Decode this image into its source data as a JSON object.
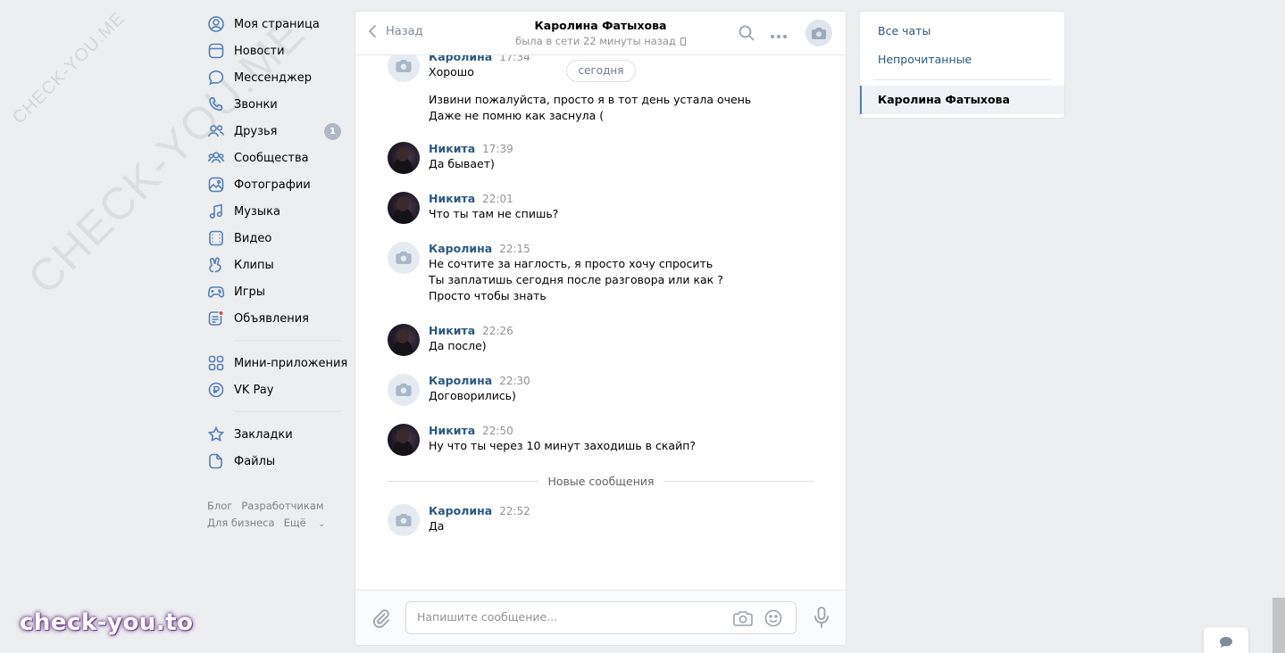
{
  "watermark": {
    "small": "CHECK-YOU.ME",
    "large": "CHECK-YOU.ME",
    "brand": "check-you.to"
  },
  "nav": {
    "items": [
      {
        "label": "Моя страница",
        "icon": "user-circle-icon"
      },
      {
        "label": "Новости",
        "icon": "news-icon"
      },
      {
        "label": "Мессенджер",
        "icon": "message-icon"
      },
      {
        "label": "Звонки",
        "icon": "phone-icon"
      },
      {
        "label": "Друзья",
        "icon": "friends-icon",
        "badge": "1"
      },
      {
        "label": "Сообщества",
        "icon": "communities-icon"
      },
      {
        "label": "Фотографии",
        "icon": "photos-icon"
      },
      {
        "label": "Музыка",
        "icon": "music-icon"
      },
      {
        "label": "Видео",
        "icon": "video-icon"
      },
      {
        "label": "Клипы",
        "icon": "clips-icon"
      },
      {
        "label": "Игры",
        "icon": "games-icon"
      },
      {
        "label": "Объявления",
        "icon": "ads-icon"
      },
      {
        "label": "Мини-приложения",
        "icon": "apps-icon"
      },
      {
        "label": "VK Pay",
        "icon": "vkpay-icon"
      },
      {
        "label": "Закладки",
        "icon": "bookmark-icon"
      },
      {
        "label": "Файлы",
        "icon": "files-icon"
      }
    ],
    "footer": [
      "Блог",
      "Разработчикам",
      "Для бизнеса",
      "Ещё"
    ]
  },
  "chat": {
    "back_label": "Назад",
    "title": "Каролина Фатыхова",
    "status": "была в сети 22 минуты назад",
    "date_pill": "сегодня",
    "new_messages": "Новые сообщения",
    "messages": [
      {
        "author": "Каролина",
        "time": "17:34",
        "lines": [
          "Хорошо"
        ],
        "extra": [
          "Извини пожалуйста, просто я в тот день устала очень",
          "Даже не помню как заснула ("
        ]
      },
      {
        "author": "Никита",
        "time": "17:39",
        "lines": [
          "Да бывает)"
        ]
      },
      {
        "author": "Никита",
        "time": "22:01",
        "lines": [
          "Что ты там не спишь?"
        ]
      },
      {
        "author": "Каролина",
        "time": "22:15",
        "lines": [
          "Не сочтите за наглость, я просто хочу спросить",
          "Ты заплатишь сегодня после разговора или как ?",
          "Просто чтобы знать"
        ]
      },
      {
        "author": "Никита",
        "time": "22:26",
        "lines": [
          "Да после)"
        ]
      },
      {
        "author": "Каролина",
        "time": "22:30",
        "lines": [
          "Договорились)"
        ]
      },
      {
        "author": "Никита",
        "time": "22:50",
        "lines": [
          "Ну что ты через 10 минут заходишь в скайп?"
        ]
      },
      {
        "author": "Каролина",
        "time": "22:52",
        "lines": [
          "Да"
        ]
      }
    ],
    "composer_placeholder": "Напишите сообщение..."
  },
  "right_panel": {
    "all_chats": "Все чаты",
    "unread": "Непрочитанные",
    "active_chat": "Каролина Фатыхова"
  },
  "colors": {
    "link": "#2a5885",
    "accent": "#5181b8",
    "background": "#edeef0"
  }
}
